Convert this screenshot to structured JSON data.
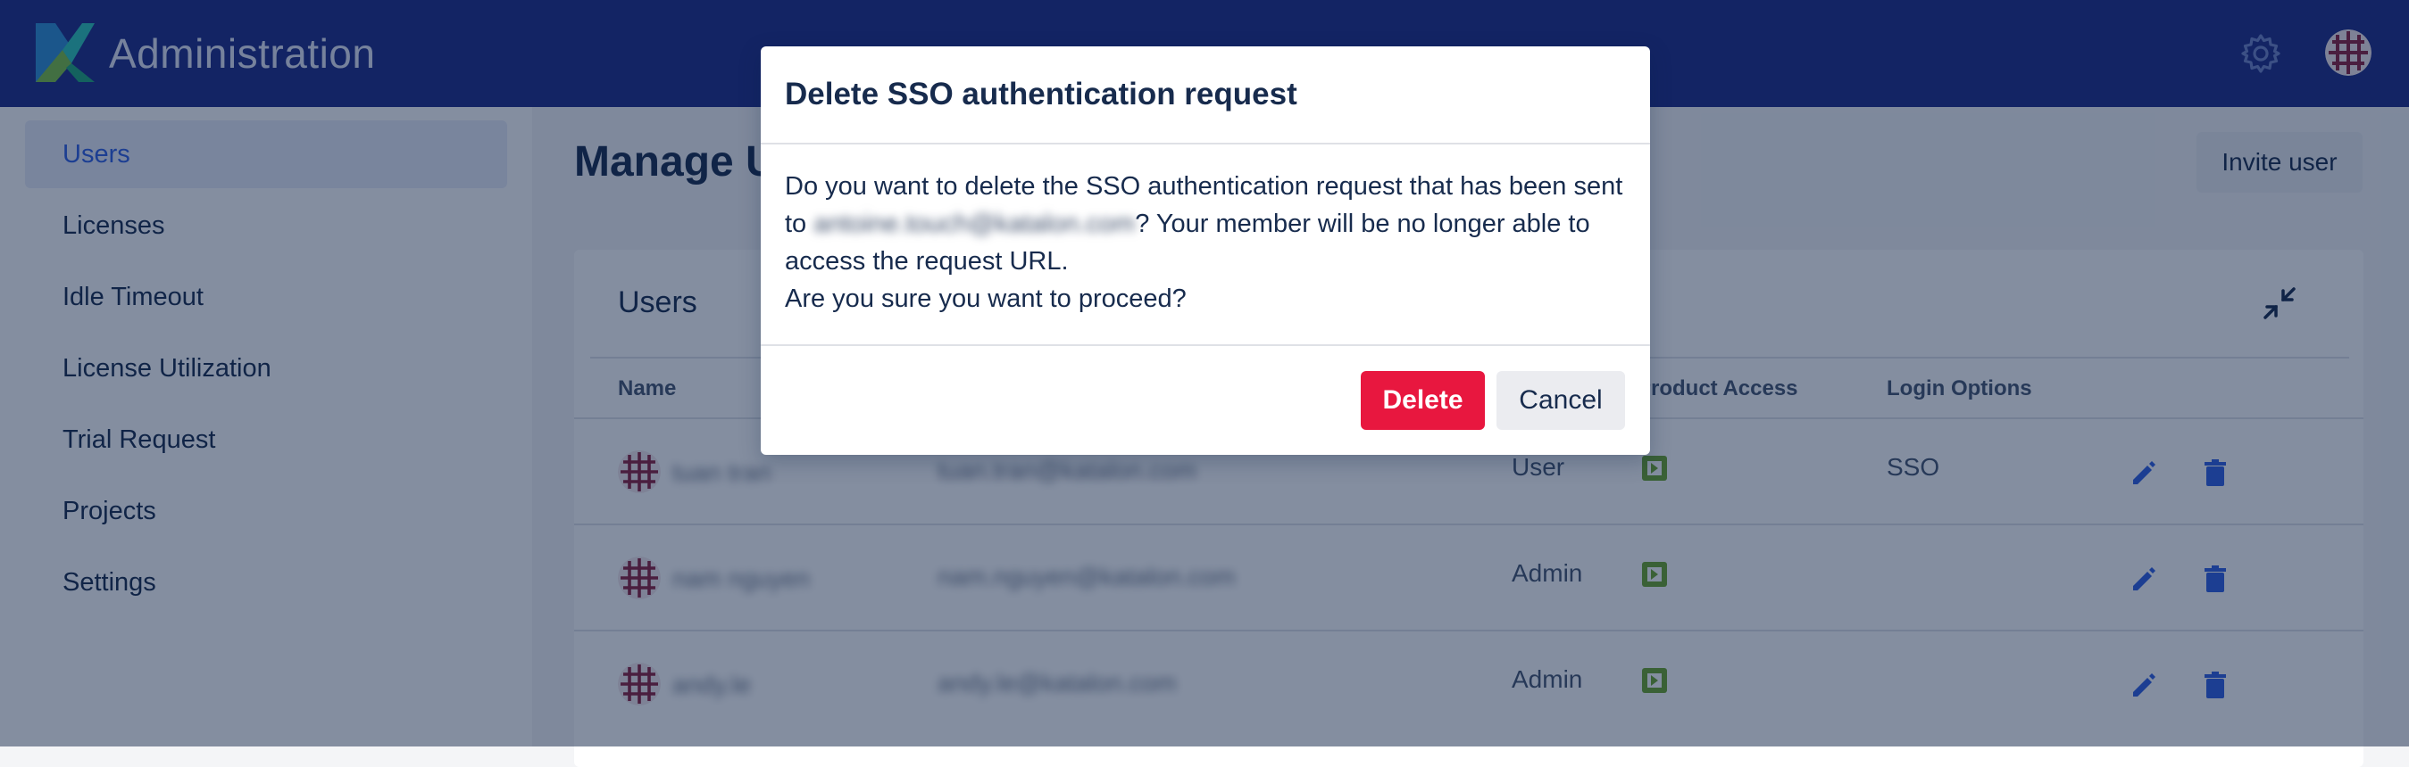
{
  "header": {
    "app_title": "Administration",
    "settings_icon": "gear-icon",
    "avatar_icon": "user-avatar"
  },
  "sidebar": {
    "items": [
      {
        "label": "Users",
        "active": true
      },
      {
        "label": "Licenses"
      },
      {
        "label": "Idle Timeout"
      },
      {
        "label": "License Utilization"
      },
      {
        "label": "Trial Request"
      },
      {
        "label": "Projects"
      },
      {
        "label": "Settings"
      }
    ]
  },
  "main": {
    "page_title": "Manage Users",
    "invite_button": "Invite user",
    "card_title": "Users",
    "columns": {
      "name": "Name",
      "product_access": "Product Access",
      "login_options": "Login Options"
    },
    "rows": [
      {
        "name": "tuan tran",
        "email": "tuan.tran@katalon.com",
        "role": "User",
        "login": "SSO"
      },
      {
        "name": "nam nguyen",
        "email": "nam.nguyen@katalon.com",
        "role": "Admin",
        "login": ""
      },
      {
        "name": "andy.le",
        "email": "andy.le@katalon.com",
        "role": "Admin",
        "login": ""
      }
    ]
  },
  "modal": {
    "title": "Delete SSO authentication request",
    "body_prefix": "Do you want to delete the SSO authentication request that has been sent to ",
    "body_email": "antoine.touch@katalon.com",
    "body_suffix": "? Your member will be no longer able to access the request URL.",
    "body_confirm": "Are you sure you want to proceed?",
    "delete_label": "Delete",
    "cancel_label": "Cancel"
  },
  "colors": {
    "header_bg": "#1c2a87",
    "accent": "#2f5fe3",
    "danger": "#e8173f",
    "product_icon": "#6aa52b"
  }
}
